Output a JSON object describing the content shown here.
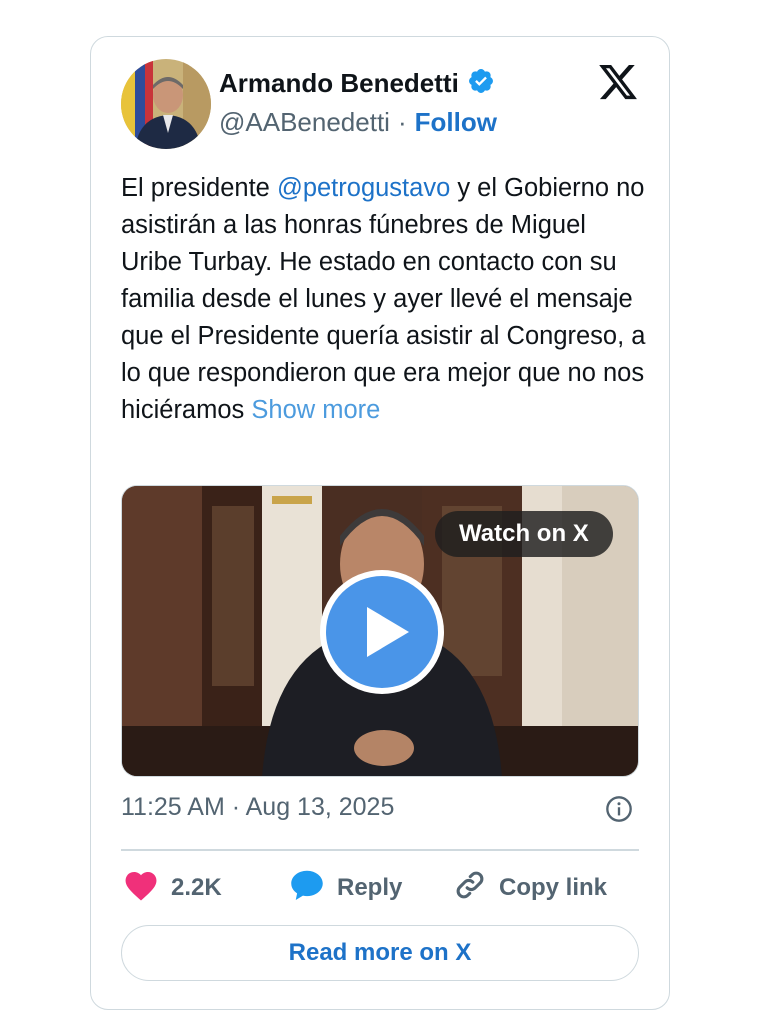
{
  "author": {
    "name": "Armando Benedetti",
    "handle": "@AABenedetti",
    "separator": "·",
    "follow_label": "Follow",
    "verified_icon": "verified-badge-icon"
  },
  "tweet": {
    "text_before_mention": "El presidente ",
    "mention": "@petrogustavo",
    "text_after_mention": " y el Gobierno no asistirán a las honras fúnebres de Miguel Uribe Turbay. He estado en contacto con su familia desde el lunes y ayer llevé el mensaje que el Presidente quería asistir al Congreso, a lo que respondieron que era mejor que no nos hiciéramos ",
    "show_more_label": "Show more"
  },
  "media": {
    "watch_label": "Watch on X",
    "play_icon": "play-icon"
  },
  "timestamp": "11:25 AM · Aug 13, 2025",
  "actions": {
    "likes": "2.2K",
    "reply_label": "Reply",
    "copy_link_label": "Copy link"
  },
  "read_more_label": "Read more on X",
  "colors": {
    "link_blue": "#1d72c8",
    "heart_pink": "#f0307a",
    "reply_blue": "#1d9bf0",
    "play_blue": "#4a95e8"
  }
}
